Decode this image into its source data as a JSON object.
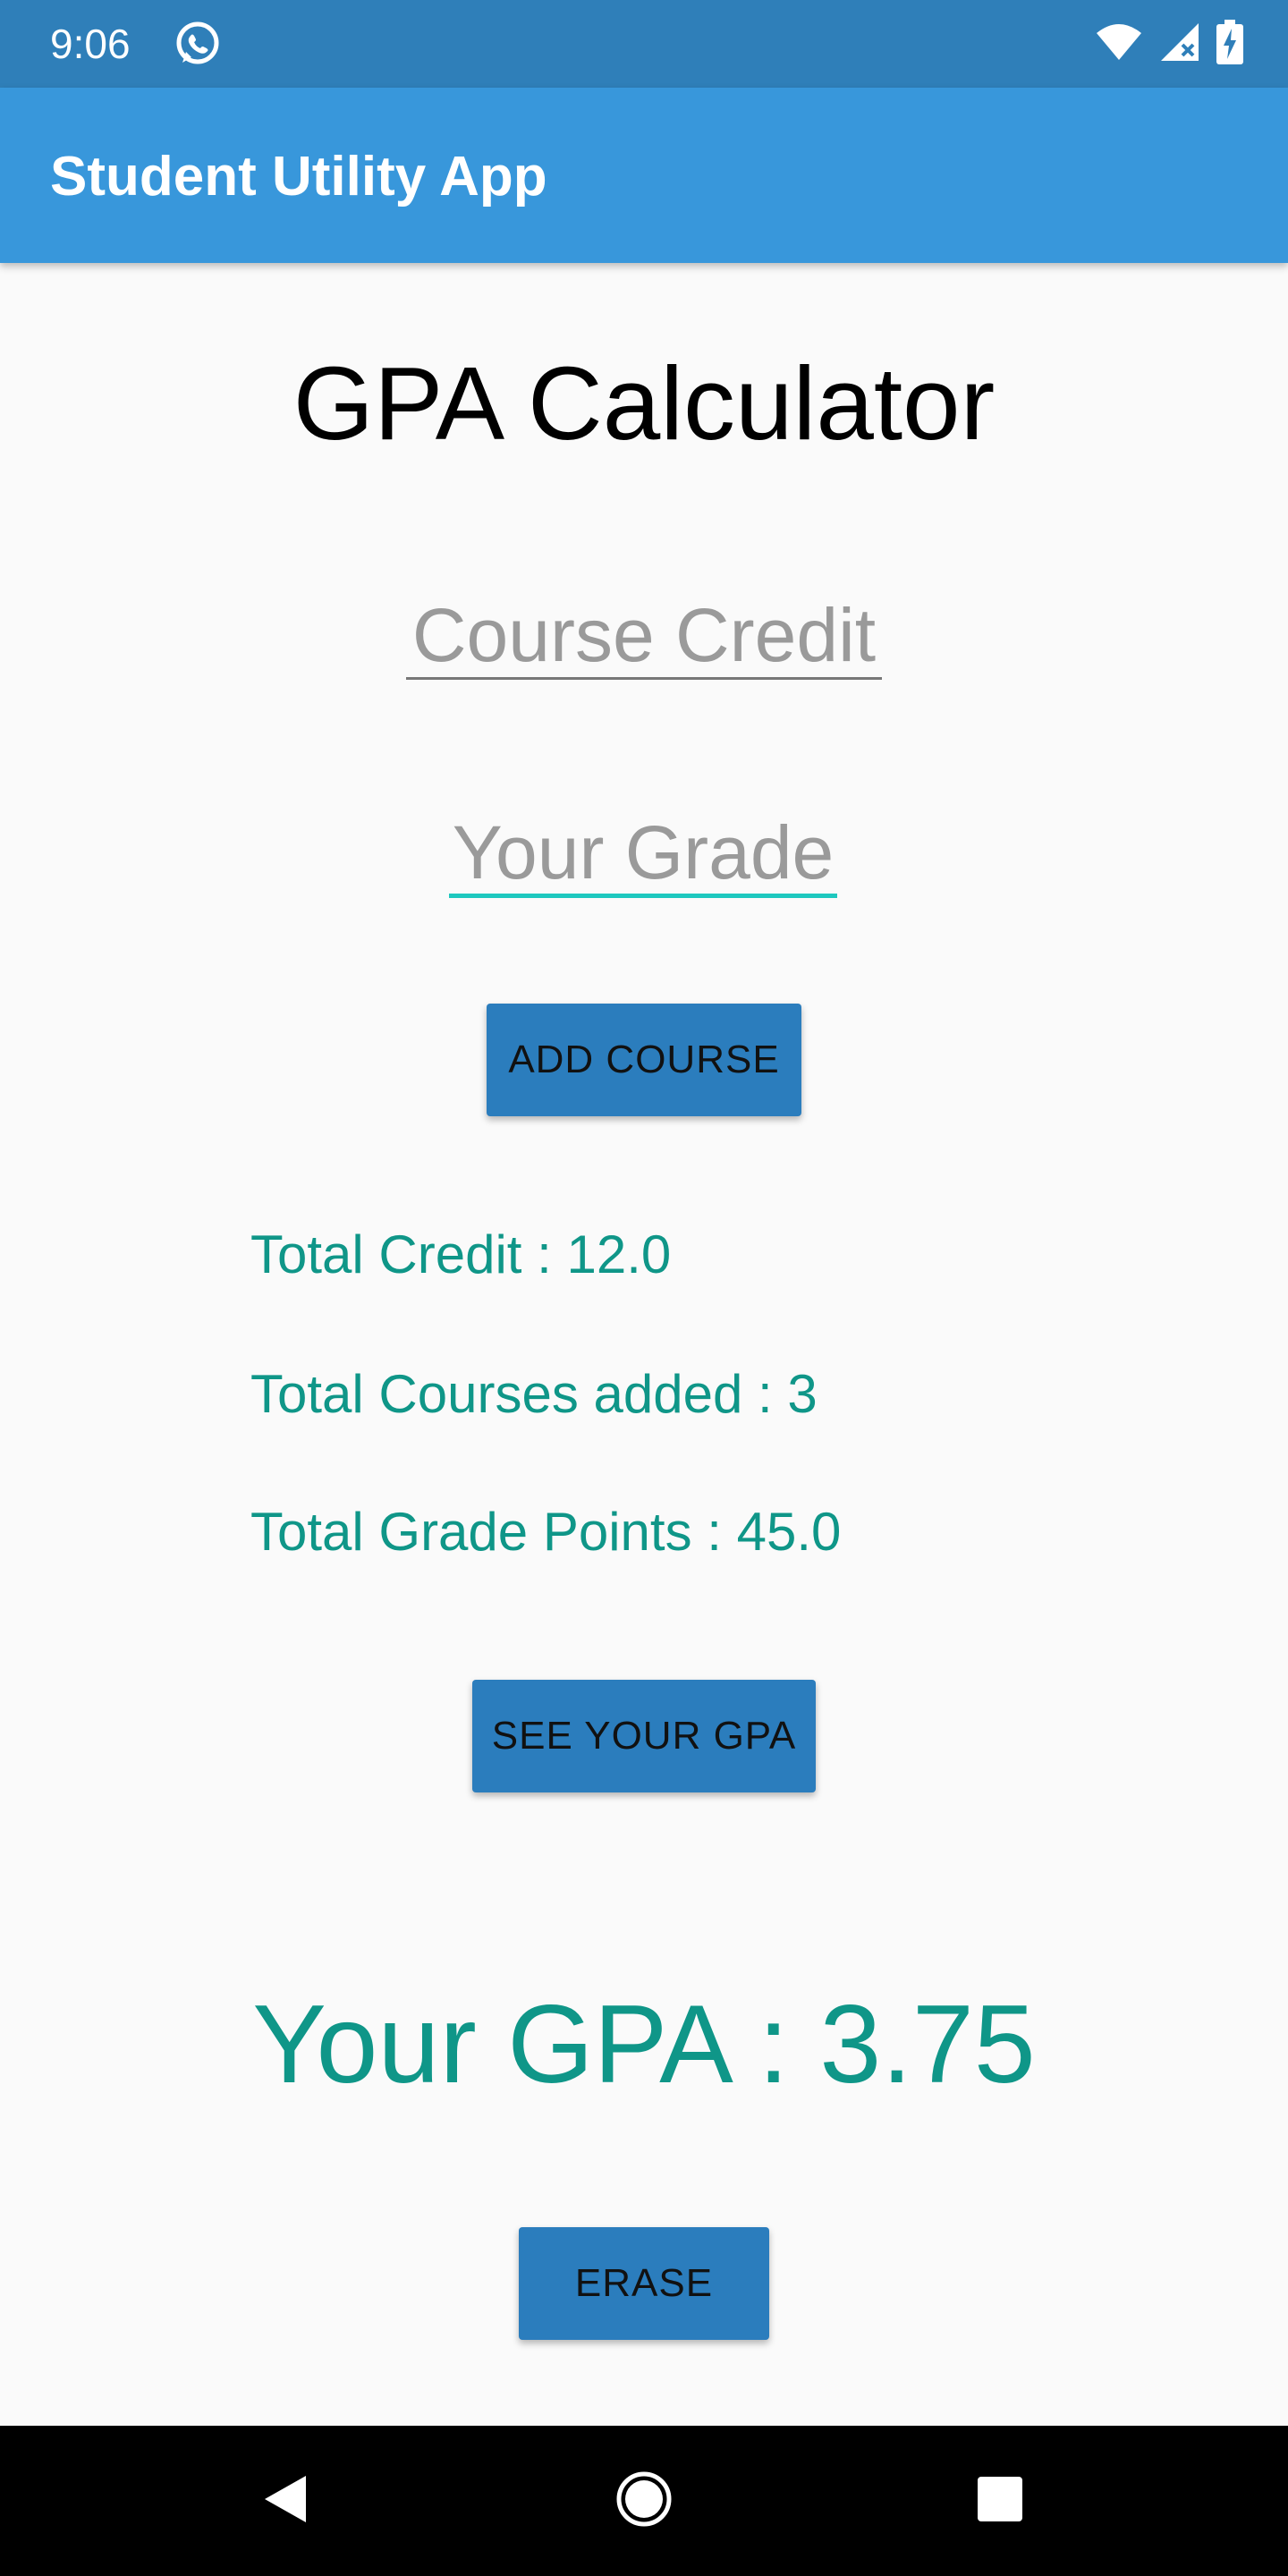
{
  "status_bar": {
    "time": "9:06",
    "icons": [
      "whatsapp-icon",
      "wifi-icon",
      "cellular-no-signal-icon",
      "battery-charging-icon"
    ]
  },
  "app_bar": {
    "title": "Student Utility App"
  },
  "main": {
    "title": "GPA Calculator",
    "course_credit": {
      "placeholder": "Course Credit",
      "value": ""
    },
    "your_grade": {
      "placeholder": "Your Grade",
      "value": ""
    },
    "add_course_label": "ADD COURSE",
    "total_credit": "Total Credit : 12.0",
    "total_courses": "Total Courses added : 3",
    "total_grade_points": "Total Grade Points : 45.0",
    "see_gpa_label": "SEE YOUR GPA",
    "gpa_result": "Your GPA : 3.75",
    "erase_label": "ERASE"
  },
  "nav_bar": {
    "icons": [
      "back-icon",
      "home-icon",
      "recents-icon"
    ]
  },
  "colors": {
    "status_bar": "#2f7fb9",
    "app_bar": "#3897db",
    "button": "#2b7dbd",
    "accent_teal": "#0f9688",
    "focus_underline": "#1ec8bf",
    "background": "#fafafa"
  }
}
